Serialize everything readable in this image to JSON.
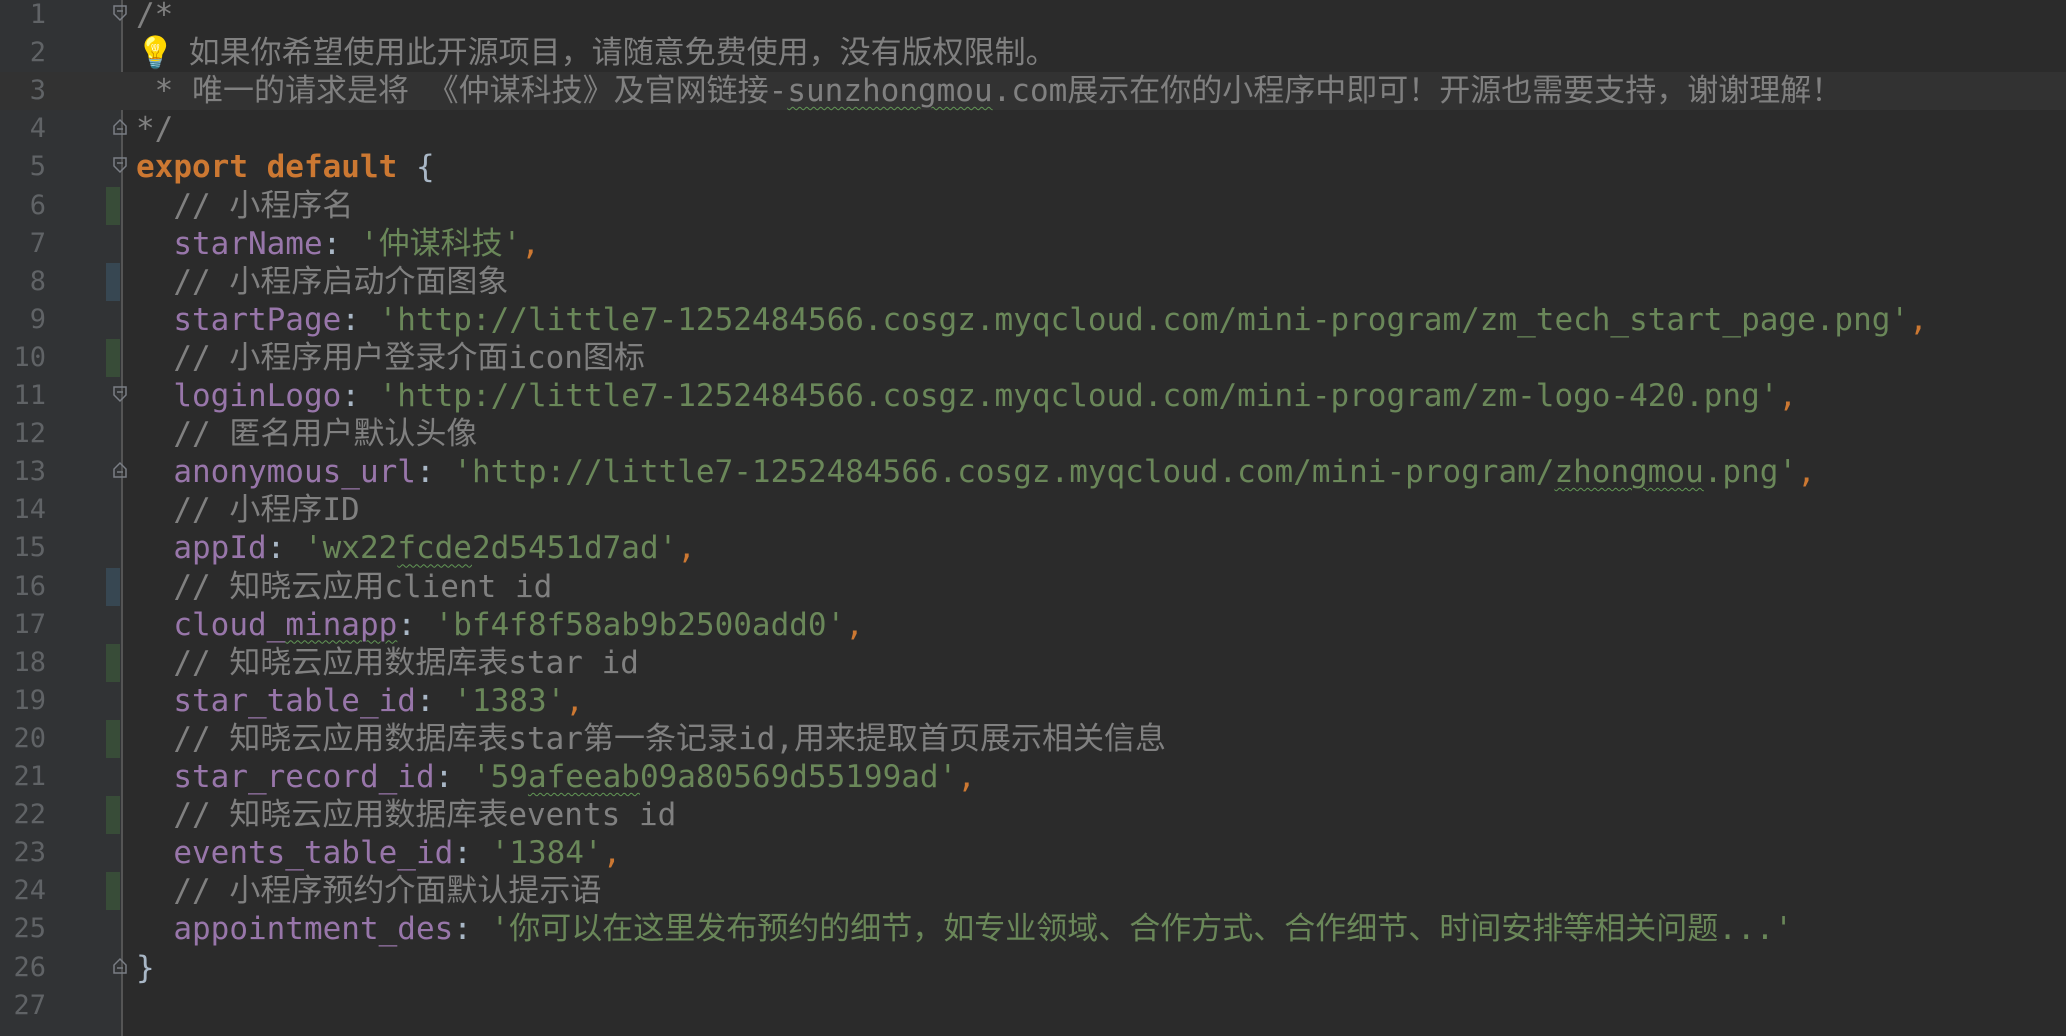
{
  "editor": {
    "lines": [
      {
        "n": "1",
        "parts": [
          {
            "t": "/*",
            "c": "comment"
          }
        ],
        "fold": "open"
      },
      {
        "n": "2",
        "parts": [
          {
            "t": " 如果你希望使用此开源项目，请随意免费使用，没有版权限制。",
            "c": "comment"
          }
        ],
        "bulb": true
      },
      {
        "n": "3",
        "parts": [
          {
            "t": " * 唯一的请求是将 《仲谋科技》及官网链接-",
            "c": "comment"
          },
          {
            "t": "sunzhongmou",
            "c": "comment squiggle"
          },
          {
            "t": ".com展示在你的小程序中即可！开源也需要支持，谢谢理解！",
            "c": "comment"
          }
        ],
        "current": true
      },
      {
        "n": "4",
        "parts": [
          {
            "t": "*/",
            "c": "comment"
          }
        ],
        "fold": "close"
      },
      {
        "n": "5",
        "parts": [
          {
            "t": "export default ",
            "c": "kw"
          },
          {
            "t": "{",
            "c": "brace"
          }
        ],
        "fold": "open"
      },
      {
        "n": "6",
        "parts": [
          {
            "t": "  // 小程序名",
            "c": "comment"
          }
        ],
        "vcs": "added"
      },
      {
        "n": "7",
        "parts": [
          {
            "t": "  starName",
            "c": "prop"
          },
          {
            "t": ": ",
            "c": "brace"
          },
          {
            "t": "'仲谋科技'",
            "c": "str"
          },
          {
            "t": ",",
            "c": "punc"
          }
        ]
      },
      {
        "n": "8",
        "parts": [
          {
            "t": "  // 小程序启动介面图象",
            "c": "comment"
          }
        ],
        "vcs": "modified"
      },
      {
        "n": "9",
        "parts": [
          {
            "t": "  startPage",
            "c": "prop"
          },
          {
            "t": ": ",
            "c": "brace"
          },
          {
            "t": "'http://little7-1252484566.cosgz.myqcloud.com/mini-program/zm_tech_start_page.png'",
            "c": "str"
          },
          {
            "t": ",",
            "c": "punc"
          }
        ]
      },
      {
        "n": "10",
        "parts": [
          {
            "t": "  // 小程序用户登录介面icon图标",
            "c": "comment"
          }
        ],
        "vcs": "added"
      },
      {
        "n": "11",
        "parts": [
          {
            "t": "  loginLogo",
            "c": "prop"
          },
          {
            "t": ": ",
            "c": "brace"
          },
          {
            "t": "'http://little7-1252484566.cosgz.myqcloud.com/mini-program/zm-logo-420.png'",
            "c": "str"
          },
          {
            "t": ",",
            "c": "punc"
          }
        ],
        "fold": "open"
      },
      {
        "n": "12",
        "parts": [
          {
            "t": "  // 匿名用户默认头像",
            "c": "comment"
          }
        ]
      },
      {
        "n": "13",
        "parts": [
          {
            "t": "  anonymous_url",
            "c": "prop"
          },
          {
            "t": ": ",
            "c": "brace"
          },
          {
            "t": "'http://little7-1252484566.cosgz.myqcloud.com/mini-program/",
            "c": "str"
          },
          {
            "t": "zhongmou",
            "c": "str squiggle"
          },
          {
            "t": ".png'",
            "c": "str"
          },
          {
            "t": ",",
            "c": "punc"
          }
        ],
        "fold": "close"
      },
      {
        "n": "14",
        "parts": [
          {
            "t": "  // 小程序ID",
            "c": "comment"
          }
        ]
      },
      {
        "n": "15",
        "parts": [
          {
            "t": "  appId",
            "c": "prop"
          },
          {
            "t": ": ",
            "c": "brace"
          },
          {
            "t": "'wx22",
            "c": "str"
          },
          {
            "t": "fcde",
            "c": "str squiggle"
          },
          {
            "t": "2d5451d7ad'",
            "c": "str"
          },
          {
            "t": ",",
            "c": "punc"
          }
        ]
      },
      {
        "n": "16",
        "parts": [
          {
            "t": "  // 知晓云应用client id",
            "c": "comment"
          }
        ],
        "vcs": "modified"
      },
      {
        "n": "17",
        "parts": [
          {
            "t": "  cloud_",
            "c": "prop"
          },
          {
            "t": "minapp",
            "c": "prop squiggle"
          },
          {
            "t": ": ",
            "c": "brace"
          },
          {
            "t": "'bf4f8f58ab9b2500add0'",
            "c": "str"
          },
          {
            "t": ",",
            "c": "punc"
          }
        ]
      },
      {
        "n": "18",
        "parts": [
          {
            "t": "  // 知晓云应用数据库表star id",
            "c": "comment"
          }
        ],
        "vcs": "added"
      },
      {
        "n": "19",
        "parts": [
          {
            "t": "  star_table_id",
            "c": "prop"
          },
          {
            "t": ": ",
            "c": "brace"
          },
          {
            "t": "'1383'",
            "c": "str"
          },
          {
            "t": ",",
            "c": "punc"
          }
        ]
      },
      {
        "n": "20",
        "parts": [
          {
            "t": "  // 知晓云应用数据库表star第一条记录id,用来提取首页展示相关信息",
            "c": "comment"
          }
        ],
        "vcs": "added"
      },
      {
        "n": "21",
        "parts": [
          {
            "t": "  star_record_id",
            "c": "prop"
          },
          {
            "t": ": ",
            "c": "brace"
          },
          {
            "t": "'59",
            "c": "str"
          },
          {
            "t": "afeeab",
            "c": "str squiggle"
          },
          {
            "t": "09a80569d55199ad'",
            "c": "str"
          },
          {
            "t": ",",
            "c": "punc"
          }
        ]
      },
      {
        "n": "22",
        "parts": [
          {
            "t": "  // 知晓云应用数据库表events id",
            "c": "comment"
          }
        ],
        "vcs": "added"
      },
      {
        "n": "23",
        "parts": [
          {
            "t": "  events_table_id",
            "c": "prop"
          },
          {
            "t": ": ",
            "c": "brace"
          },
          {
            "t": "'1384'",
            "c": "str"
          },
          {
            "t": ",",
            "c": "punc"
          }
        ]
      },
      {
        "n": "24",
        "parts": [
          {
            "t": "  // 小程序预约介面默认提示语",
            "c": "comment"
          }
        ],
        "vcs": "added"
      },
      {
        "n": "25",
        "parts": [
          {
            "t": "  appointment_des",
            "c": "prop"
          },
          {
            "t": ": ",
            "c": "brace"
          },
          {
            "t": "'你可以在这里发布预约的细节，如专业领域、合作方式、合作细节、时间安排等相关问题...'",
            "c": "str"
          }
        ]
      },
      {
        "n": "26",
        "parts": [
          {
            "t": "}",
            "c": "brace"
          }
        ],
        "fold": "close"
      },
      {
        "n": "27",
        "parts": []
      }
    ]
  },
  "colors": {
    "background": "#2b2b2b",
    "gutter": "#313335",
    "keyword": "#cc7832",
    "comment": "#808080",
    "property": "#9876aa",
    "string": "#6a8759"
  }
}
